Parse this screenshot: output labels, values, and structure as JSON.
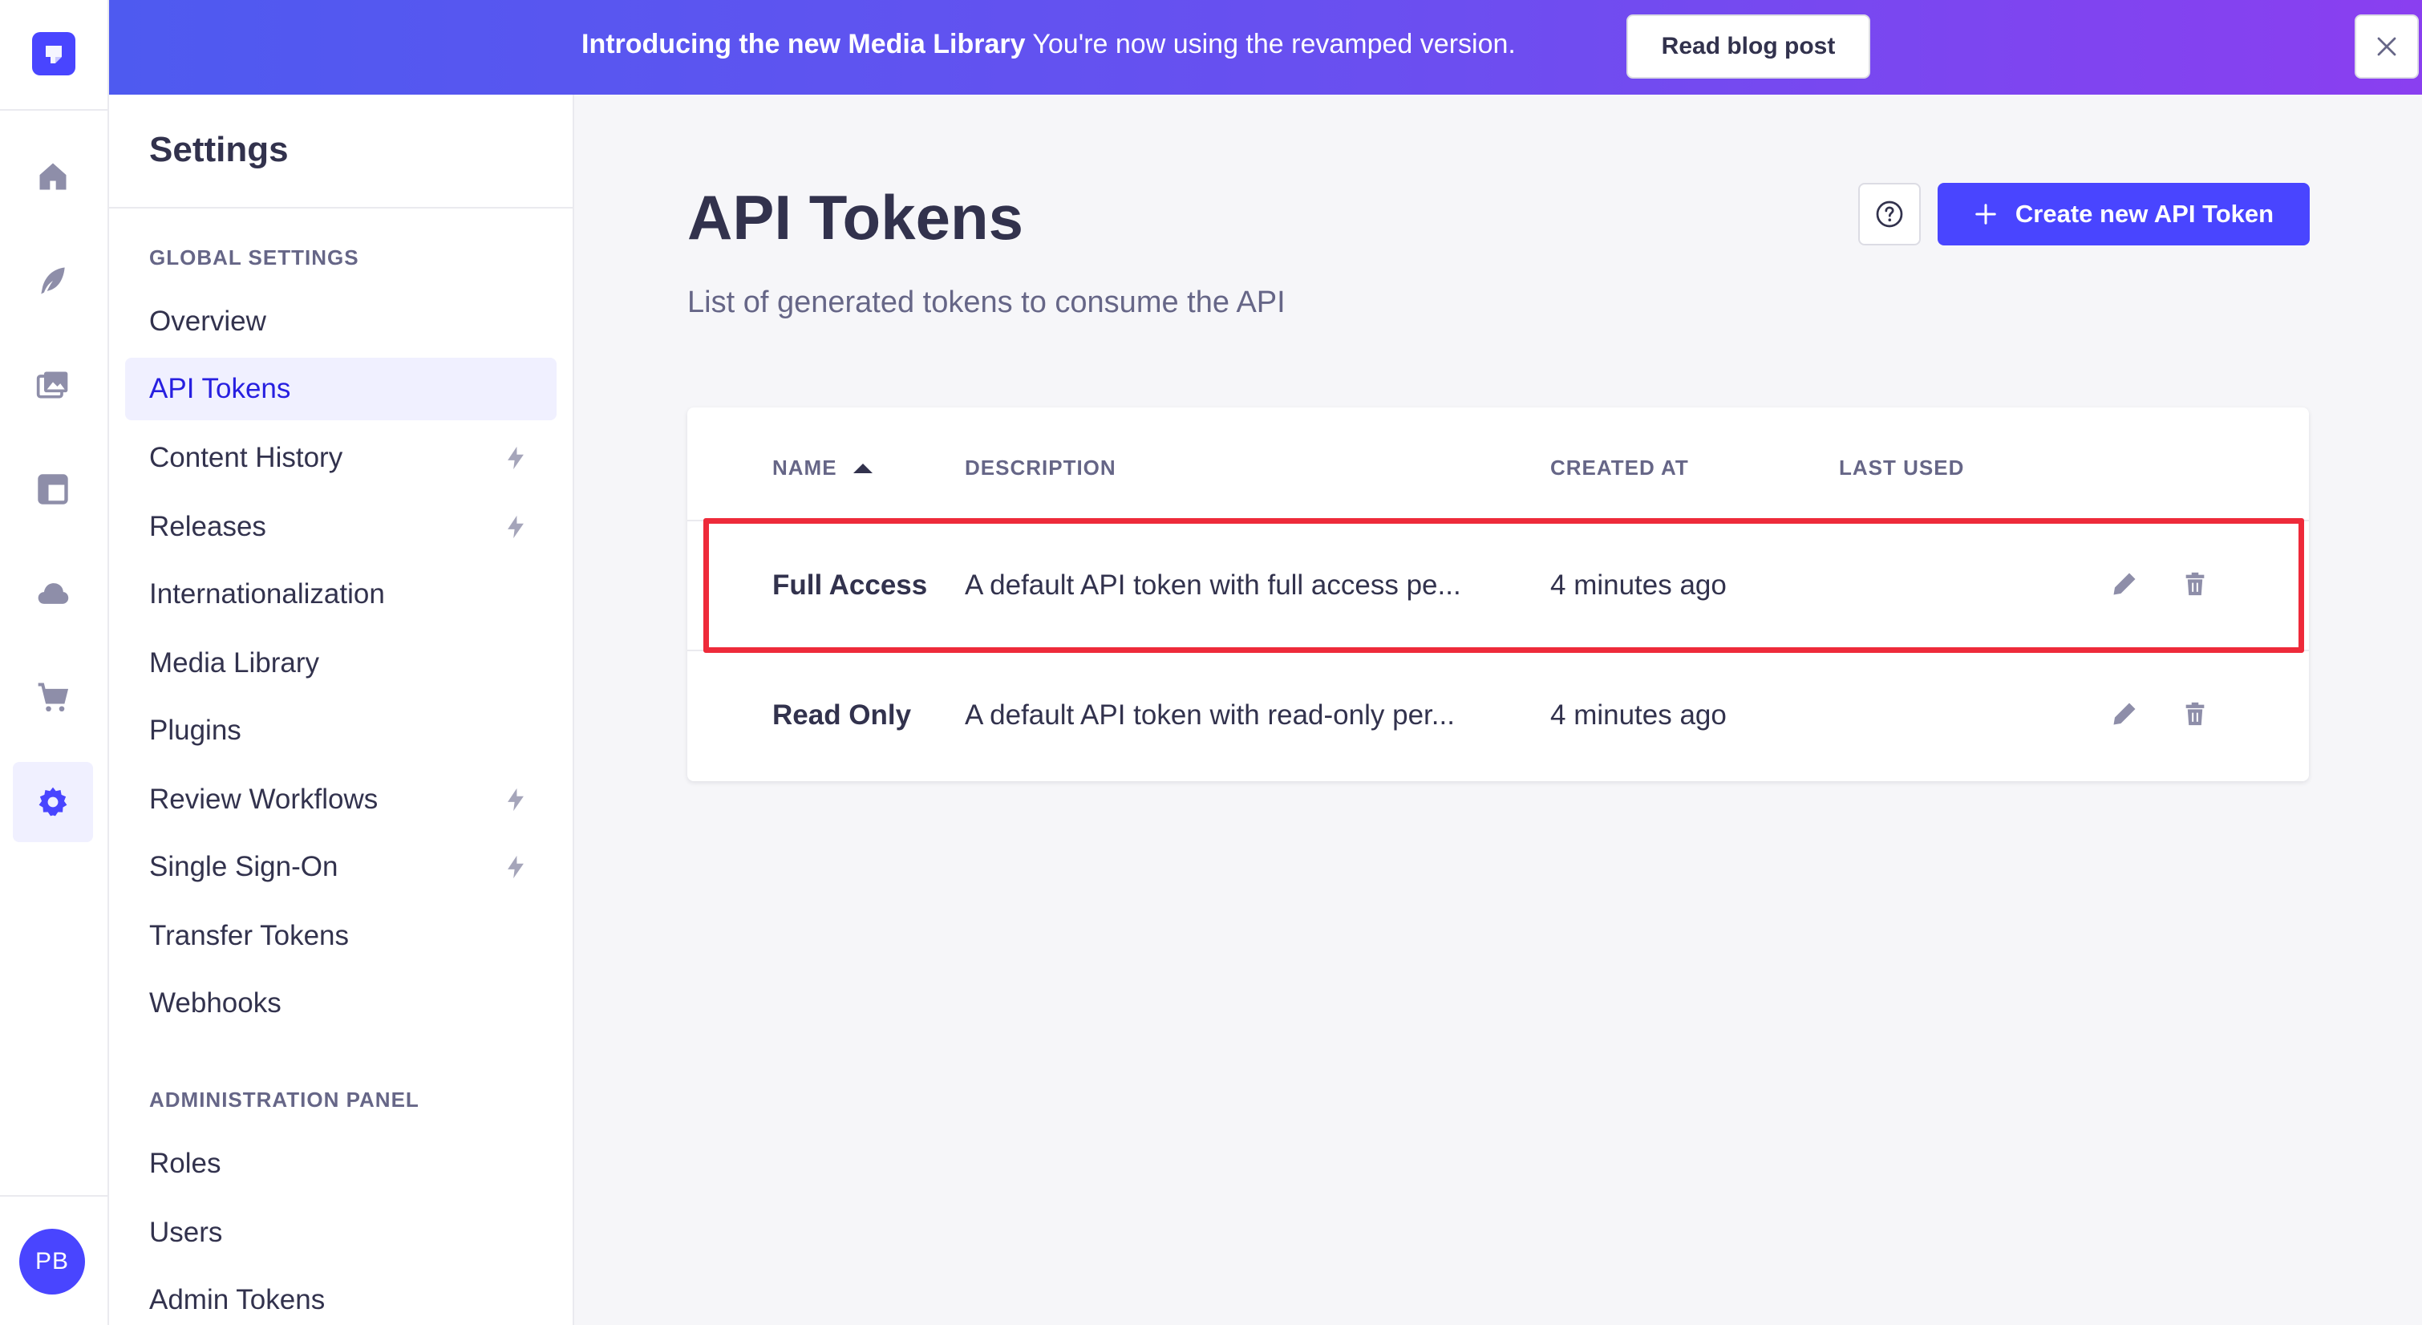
{
  "banner": {
    "title": "Introducing the new Media Library",
    "message": "You're now using the revamped version.",
    "button_label": "Read blog post"
  },
  "rail": {
    "items": [
      {
        "name": "home-icon"
      },
      {
        "name": "content-manager-icon"
      },
      {
        "name": "media-library-icon"
      },
      {
        "name": "content-type-builder-icon"
      },
      {
        "name": "cloud-icon"
      },
      {
        "name": "marketplace-icon"
      },
      {
        "name": "settings-icon"
      }
    ],
    "avatar_initials": "PB"
  },
  "sidebar": {
    "title": "Settings",
    "global_section": "GLOBAL SETTINGS",
    "global_items": [
      {
        "label": "Overview"
      },
      {
        "label": "API Tokens"
      },
      {
        "label": "Content History"
      },
      {
        "label": "Releases"
      },
      {
        "label": "Internationalization"
      },
      {
        "label": "Media Library"
      },
      {
        "label": "Plugins"
      },
      {
        "label": "Review Workflows"
      },
      {
        "label": "Single Sign-On"
      },
      {
        "label": "Transfer Tokens"
      },
      {
        "label": "Webhooks"
      }
    ],
    "admin_section": "ADMINISTRATION PANEL",
    "admin_items": [
      {
        "label": "Roles"
      },
      {
        "label": "Users"
      },
      {
        "label": "Admin Tokens"
      }
    ]
  },
  "main": {
    "title": "API Tokens",
    "subtitle": "List of generated tokens to consume the API",
    "create_button_label": "Create new API Token",
    "table": {
      "headers": [
        "NAME",
        "DESCRIPTION",
        "CREATED AT",
        "LAST USED"
      ],
      "rows": [
        {
          "name": "Full Access",
          "description": "A default API token with full access pe...",
          "created_at": "4 minutes ago",
          "last_used": ""
        },
        {
          "name": "Read Only",
          "description": "A default API token with read-only per...",
          "created_at": "4 minutes ago",
          "last_used": ""
        }
      ]
    }
  },
  "colors": {
    "primary": "#4945ff",
    "highlight": "#ee2a3a",
    "text": "#32324d",
    "muted": "#666687"
  }
}
